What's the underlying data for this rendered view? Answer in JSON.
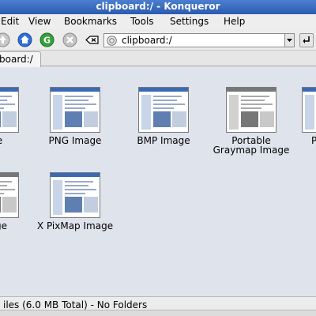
{
  "window": {
    "title": "clipboard:/ - Konqueror"
  },
  "menu": {
    "items": [
      "Edit",
      "View",
      "Bookmarks",
      "Tools",
      "Settings",
      "Help"
    ]
  },
  "location": {
    "value": "clipboard:/"
  },
  "tab": {
    "label": "board:/"
  },
  "files": [
    {
      "name": "age"
    },
    {
      "name": "PNG Image"
    },
    {
      "name": "BMP Image"
    },
    {
      "name": "Portable Graymap Image",
      "grayscale": true
    },
    {
      "name": "Pi"
    },
    {
      "name": "mage",
      "grayscale": true
    },
    {
      "name": "X PixMap Image"
    }
  ],
  "status": {
    "text": "iles (6.0 MB Total) - No Folders"
  }
}
